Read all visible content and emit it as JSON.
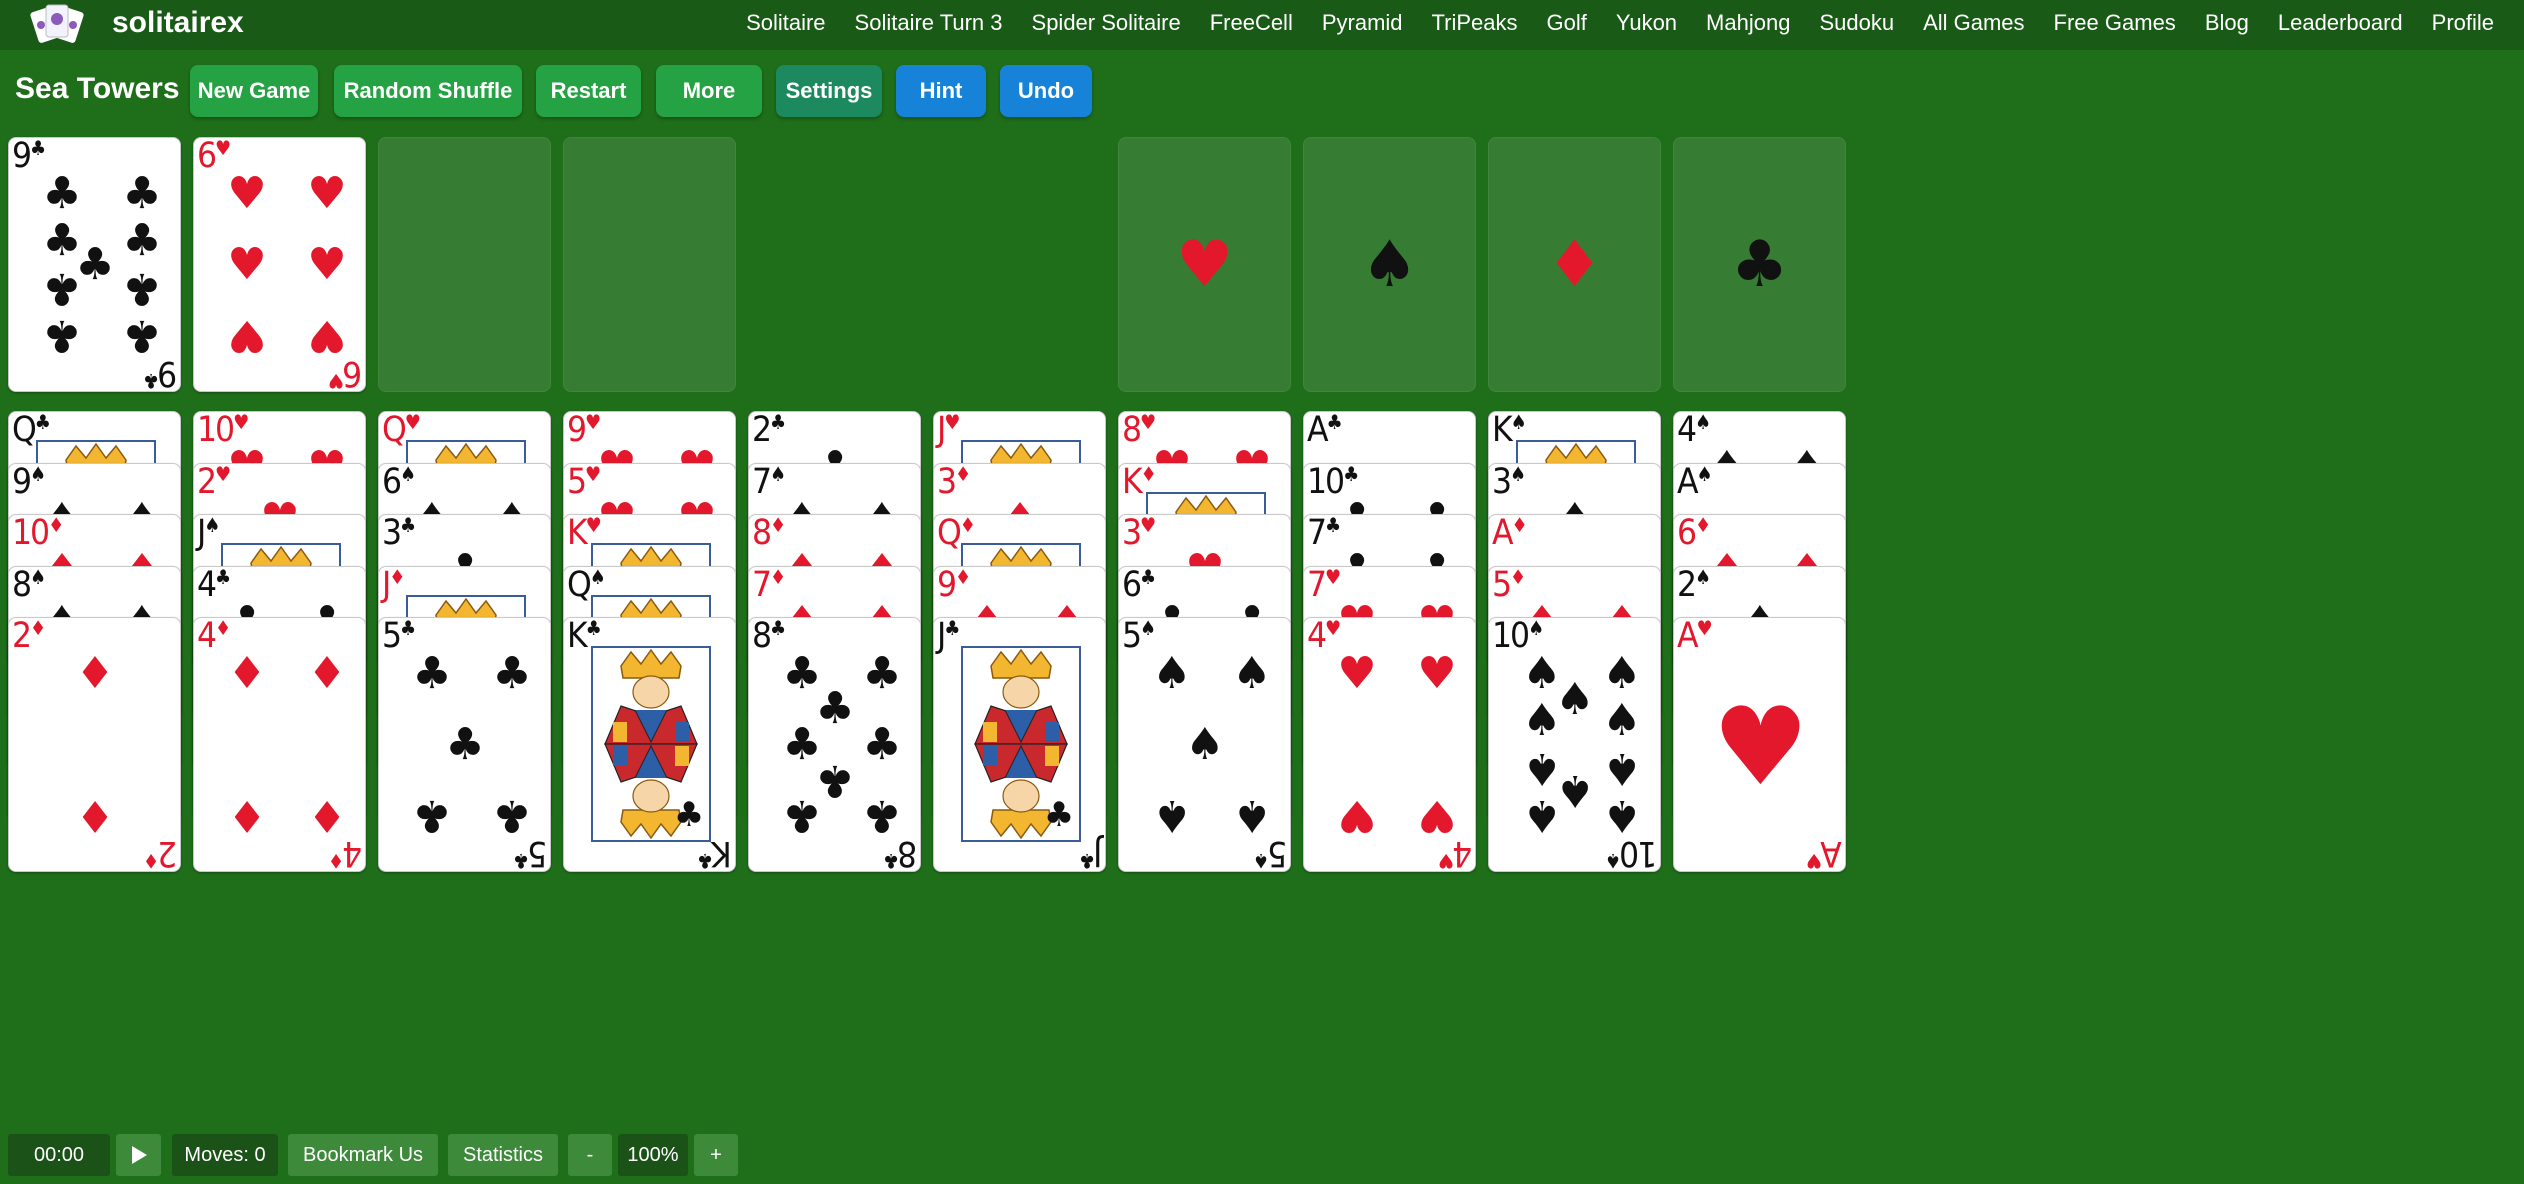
{
  "brand": "solitairex",
  "nav": [
    "Solitaire",
    "Solitaire Turn 3",
    "Spider Solitaire",
    "FreeCell",
    "Pyramid",
    "TriPeaks",
    "Golf",
    "Yukon",
    "Mahjong",
    "Sudoku",
    "All Games",
    "Free Games",
    "Blog",
    "Leaderboard",
    "Profile"
  ],
  "game_title": "Sea Towers",
  "toolbar": {
    "new_game": "New Game",
    "random_shuffle": "Random Shuffle",
    "restart": "Restart",
    "more": "More",
    "settings": "Settings",
    "hint": "Hint",
    "undo": "Undo"
  },
  "colors": {
    "table": "#1e6e1a",
    "nav_bg": "#1a5a17",
    "button_green": "#25a244",
    "button_teal": "#1c8a5e",
    "button_blue": "#1683d9",
    "red_suit": "#e3182d",
    "black_suit": "#111111"
  },
  "cells": [
    {
      "rank": "9",
      "suit": "C"
    },
    {
      "rank": "6",
      "suit": "H"
    },
    null,
    null
  ],
  "foundations": [
    {
      "suit": "H",
      "symbol": "♥"
    },
    {
      "suit": "S",
      "symbol": "♠"
    },
    {
      "suit": "D",
      "symbol": "♦"
    },
    {
      "suit": "C",
      "symbol": "♣"
    }
  ],
  "tableau": [
    [
      {
        "rank": "Q",
        "suit": "C"
      },
      {
        "rank": "9",
        "suit": "S"
      },
      {
        "rank": "10",
        "suit": "D"
      },
      {
        "rank": "8",
        "suit": "S"
      },
      {
        "rank": "2",
        "suit": "D"
      }
    ],
    [
      {
        "rank": "10",
        "suit": "H"
      },
      {
        "rank": "2",
        "suit": "H"
      },
      {
        "rank": "J",
        "suit": "S"
      },
      {
        "rank": "4",
        "suit": "C"
      },
      {
        "rank": "4",
        "suit": "D"
      }
    ],
    [
      {
        "rank": "Q",
        "suit": "H"
      },
      {
        "rank": "6",
        "suit": "S"
      },
      {
        "rank": "3",
        "suit": "C"
      },
      {
        "rank": "J",
        "suit": "D"
      },
      {
        "rank": "5",
        "suit": "C"
      }
    ],
    [
      {
        "rank": "9",
        "suit": "H"
      },
      {
        "rank": "5",
        "suit": "H"
      },
      {
        "rank": "K",
        "suit": "H"
      },
      {
        "rank": "Q",
        "suit": "S"
      },
      {
        "rank": "K",
        "suit": "C"
      }
    ],
    [
      {
        "rank": "2",
        "suit": "C"
      },
      {
        "rank": "7",
        "suit": "S"
      },
      {
        "rank": "8",
        "suit": "D"
      },
      {
        "rank": "7",
        "suit": "D"
      },
      {
        "rank": "8",
        "suit": "C"
      }
    ],
    [
      {
        "rank": "J",
        "suit": "H"
      },
      {
        "rank": "3",
        "suit": "D"
      },
      {
        "rank": "Q",
        "suit": "D"
      },
      {
        "rank": "9",
        "suit": "D"
      },
      {
        "rank": "J",
        "suit": "C"
      }
    ],
    [
      {
        "rank": "8",
        "suit": "H"
      },
      {
        "rank": "K",
        "suit": "D"
      },
      {
        "rank": "3",
        "suit": "H"
      },
      {
        "rank": "6",
        "suit": "C"
      },
      {
        "rank": "5",
        "suit": "S"
      }
    ],
    [
      {
        "rank": "A",
        "suit": "C"
      },
      {
        "rank": "10",
        "suit": "C"
      },
      {
        "rank": "7",
        "suit": "C"
      },
      {
        "rank": "7",
        "suit": "H"
      },
      {
        "rank": "4",
        "suit": "H"
      }
    ],
    [
      {
        "rank": "K",
        "suit": "S"
      },
      {
        "rank": "3",
        "suit": "S"
      },
      {
        "rank": "A",
        "suit": "D"
      },
      {
        "rank": "5",
        "suit": "D"
      },
      {
        "rank": "10",
        "suit": "S"
      }
    ],
    [
      {
        "rank": "4",
        "suit": "S"
      },
      {
        "rank": "A",
        "suit": "S"
      },
      {
        "rank": "6",
        "suit": "D"
      },
      {
        "rank": "2",
        "suit": "S"
      },
      {
        "rank": "A",
        "suit": "H"
      }
    ]
  ],
  "status": {
    "timer": "00:00",
    "play_icon": "play-icon",
    "moves": "Moves: 0",
    "bookmark": "Bookmark Us",
    "statistics": "Statistics",
    "zoom_out": "-",
    "zoom": "100%",
    "zoom_in": "+"
  }
}
